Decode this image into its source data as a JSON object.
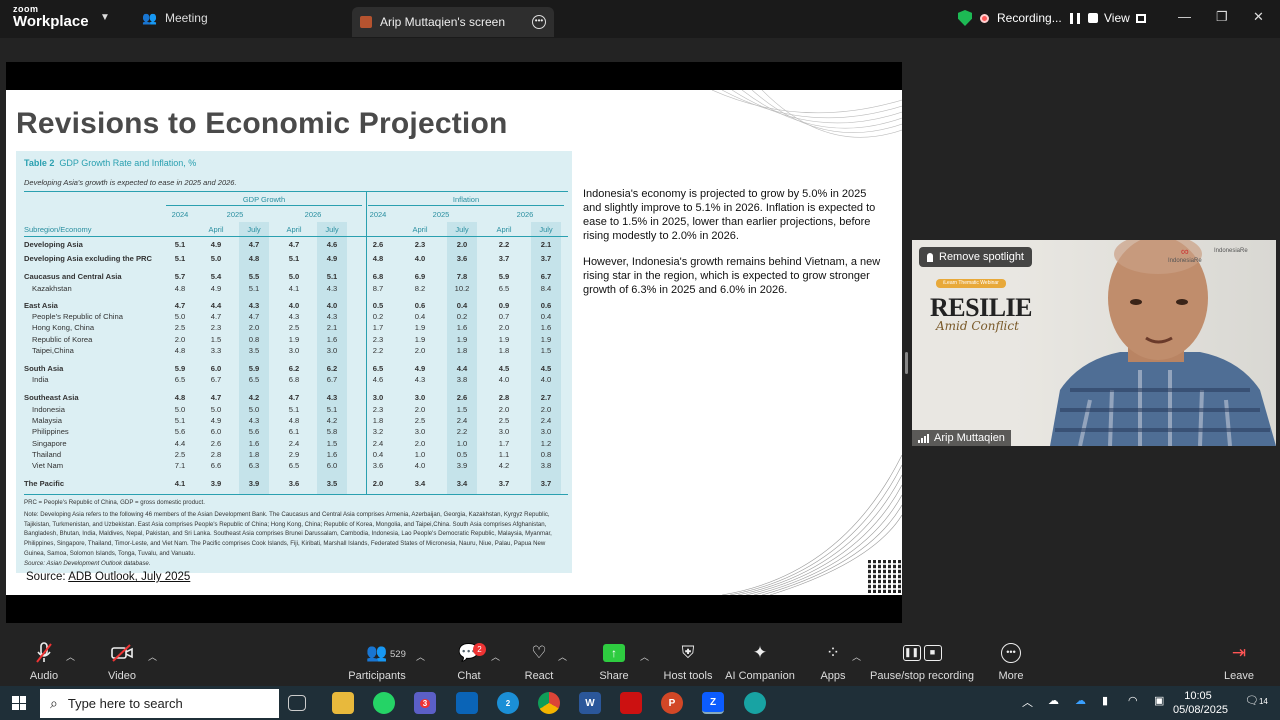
{
  "topbar": {
    "logo_line1": "zoom",
    "logo_line2": "Workplace",
    "meeting_label": "Meeting",
    "screen_tab_label": "Arip Muttaqien's screen",
    "recording_label": "Recording...",
    "view_label": "View"
  },
  "slide": {
    "title": "Revisions to Economic Projection",
    "paragraph1": "Indonesia's economy is projected to grow by 5.0% in 2025 and slightly improve to 5.1% in 2026. Inflation is expected to ease to 1.5% in 2025, lower than earlier projections, before rising modestly to 2.0% in 2026.",
    "paragraph2": "However, Indonesia's growth remains behind Vietnam, a new rising star in the region, which is expected to grow stronger growth of 6.3% in 2025 and 6.0% in 2026.",
    "source_prefix": "Source:",
    "source_link": "ADB Outlook, July 2025"
  },
  "table": {
    "title": "Table 2",
    "title_rest": "GDP Growth Rate and Inflation, %",
    "subtitle": "Developing Asia's growth is expected to ease in 2025 and 2026.",
    "group_gdp": "GDP Growth",
    "group_inflation": "Inflation",
    "years": [
      "2024",
      "2025",
      "2026",
      "2024",
      "2025",
      "2026"
    ],
    "months": [
      "April",
      "July",
      "April",
      "July",
      "April",
      "July",
      "April",
      "July"
    ],
    "row_header": "Subregion/Economy",
    "rows": [
      {
        "label": "Developing Asia",
        "bold": true,
        "v": [
          "5.1",
          "4.9",
          "4.7",
          "4.7",
          "4.6",
          "2.6",
          "2.3",
          "2.0",
          "2.2",
          "2.1"
        ]
      },
      {
        "label": "Developing Asia excluding the PRC",
        "bold": true,
        "v": [
          "5.1",
          "5.0",
          "4.8",
          "5.1",
          "4.9",
          "4.8",
          "4.0",
          "3.6",
          "3.7",
          "3.7"
        ]
      },
      {
        "label": "Caucasus and Central Asia",
        "bold": true,
        "v": [
          "5.7",
          "5.4",
          "5.5",
          "5.0",
          "5.1",
          "6.8",
          "6.9",
          "7.8",
          "5.9",
          "6.7"
        ]
      },
      {
        "label": "Kazakhstan",
        "bold": false,
        "v": [
          "4.8",
          "4.9",
          "5.1",
          "4.1",
          "4.3",
          "8.7",
          "8.2",
          "10.2",
          "6.5",
          "8.4"
        ]
      },
      {
        "label": "East Asia",
        "bold": true,
        "v": [
          "4.7",
          "4.4",
          "4.3",
          "4.0",
          "4.0",
          "0.5",
          "0.6",
          "0.4",
          "0.9",
          "0.6"
        ]
      },
      {
        "label": "People's Republic of China",
        "bold": false,
        "v": [
          "5.0",
          "4.7",
          "4.7",
          "4.3",
          "4.3",
          "0.2",
          "0.4",
          "0.2",
          "0.7",
          "0.4"
        ]
      },
      {
        "label": "Hong Kong, China",
        "bold": false,
        "v": [
          "2.5",
          "2.3",
          "2.0",
          "2.5",
          "2.1",
          "1.7",
          "1.9",
          "1.6",
          "2.0",
          "1.6"
        ]
      },
      {
        "label": "Republic of Korea",
        "bold": false,
        "v": [
          "2.0",
          "1.5",
          "0.8",
          "1.9",
          "1.6",
          "2.3",
          "1.9",
          "1.9",
          "1.9",
          "1.9"
        ]
      },
      {
        "label": "Taipei,China",
        "bold": false,
        "v": [
          "4.8",
          "3.3",
          "3.5",
          "3.0",
          "3.0",
          "2.2",
          "2.0",
          "1.8",
          "1.8",
          "1.5"
        ]
      },
      {
        "label": "South Asia",
        "bold": true,
        "v": [
          "5.9",
          "6.0",
          "5.9",
          "6.2",
          "6.2",
          "6.5",
          "4.9",
          "4.4",
          "4.5",
          "4.5"
        ]
      },
      {
        "label": "India",
        "bold": false,
        "v": [
          "6.5",
          "6.7",
          "6.5",
          "6.8",
          "6.7",
          "4.6",
          "4.3",
          "3.8",
          "4.0",
          "4.0"
        ]
      },
      {
        "label": "Southeast Asia",
        "bold": true,
        "v": [
          "4.8",
          "4.7",
          "4.2",
          "4.7",
          "4.3",
          "3.0",
          "3.0",
          "2.6",
          "2.8",
          "2.7"
        ]
      },
      {
        "label": "Indonesia",
        "bold": false,
        "v": [
          "5.0",
          "5.0",
          "5.0",
          "5.1",
          "5.1",
          "2.3",
          "2.0",
          "1.5",
          "2.0",
          "2.0"
        ]
      },
      {
        "label": "Malaysia",
        "bold": false,
        "v": [
          "5.1",
          "4.9",
          "4.3",
          "4.8",
          "4.2",
          "1.8",
          "2.5",
          "2.4",
          "2.5",
          "2.4"
        ]
      },
      {
        "label": "Philippines",
        "bold": false,
        "v": [
          "5.6",
          "6.0",
          "5.6",
          "6.1",
          "5.8",
          "3.2",
          "3.0",
          "2.2",
          "3.0",
          "3.0"
        ]
      },
      {
        "label": "Singapore",
        "bold": false,
        "v": [
          "4.4",
          "2.6",
          "1.6",
          "2.4",
          "1.5",
          "2.4",
          "2.0",
          "1.0",
          "1.7",
          "1.2"
        ]
      },
      {
        "label": "Thailand",
        "bold": false,
        "v": [
          "2.5",
          "2.8",
          "1.8",
          "2.9",
          "1.6",
          "0.4",
          "1.0",
          "0.5",
          "1.1",
          "0.8"
        ]
      },
      {
        "label": "Viet Nam",
        "bold": false,
        "v": [
          "7.1",
          "6.6",
          "6.3",
          "6.5",
          "6.0",
          "3.6",
          "4.0",
          "3.9",
          "4.2",
          "3.8"
        ]
      },
      {
        "label": "The Pacific",
        "bold": true,
        "v": [
          "4.1",
          "3.9",
          "3.9",
          "3.6",
          "3.5",
          "2.0",
          "3.4",
          "3.4",
          "3.7",
          "3.7"
        ]
      }
    ],
    "note1": "PRC = People's Republic of China, GDP = gross domestic product.",
    "note2": "Note: Developing Asia refers to the following 46 members of the Asian Development Bank. The Caucasus and Central Asia comprises Armenia, Azerbaijan, Georgia, Kazakhstan, Kyrgyz Republic, Tajikistan, Turkmenistan, and Uzbekistan. East Asia comprises People's Republic of China; Hong Kong, China; Republic of Korea, Mongolia, and Taipei,China. South Asia comprises Afghanistan, Bangladesh, Bhutan, India, Maldives, Nepal, Pakistan, and Sri Lanka. Southeast Asia comprises Brunei Darussalam, Cambodia, Indonesia, Lao People's Democratic Republic, Malaysia, Myanmar, Philippines, Singapore, Thailand, Timor-Leste, and Viet Nam. The Pacific comprises Cook Islands, Fiji, Kiribati, Marshall Islands, Federated States of Micronesia, Nauru, Niue, Palau, Papua New Guinea, Samoa, Solomon Islands, Tonga, Tuvalu, and Vanuatu.",
    "note3": "Source: Asian Development Outlook database."
  },
  "video_tile": {
    "remove_spotlight": "Remove spotlight",
    "participant_name": "Arip Muttaqien",
    "banner_pill": "iLearn Thematic Webinar",
    "banner_word": "RESILIE",
    "banner_sub": "Amid Conflict",
    "logo1": "IndonesiaRe",
    "logo2": "IndonesiaRe"
  },
  "controls": {
    "audio": "Audio",
    "video": "Video",
    "participants": "Participants",
    "participants_count": "529",
    "chat": "Chat",
    "chat_badge": "2",
    "react": "React",
    "share": "Share",
    "host_tools": "Host tools",
    "ai_companion": "AI Companion",
    "apps": "Apps",
    "pause_stop": "Pause/stop recording",
    "more": "More",
    "leave": "Leave"
  },
  "taskbar": {
    "search_placeholder": "Type here to search",
    "time": "10:05",
    "date": "05/08/2025",
    "notif_count": "14",
    "teams_badge": "3",
    "edge_badge": "2"
  },
  "colors": {
    "accent": "#2aa0b0",
    "table_bg": "#dceff3",
    "record_red": "#ff5a5a",
    "share_green": "#2ecc40"
  }
}
